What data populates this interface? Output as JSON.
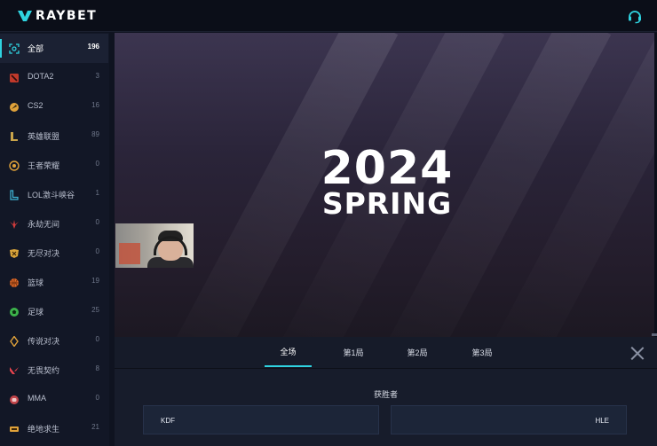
{
  "header": {
    "logo_text": "RAYBET",
    "support_icon": "headset-icon",
    "accent_color": "#2fd3e0"
  },
  "sidebar": {
    "items": [
      {
        "label": "全部",
        "count": "196",
        "icon": "all-games-icon",
        "active": true
      },
      {
        "label": "DOTA2",
        "count": "3",
        "icon": "dota2-icon"
      },
      {
        "label": "CS2",
        "count": "16",
        "icon": "cs2-icon"
      },
      {
        "label": "英雄联盟",
        "count": "89",
        "icon": "league-of-legends-icon"
      },
      {
        "label": "王者荣耀",
        "count": "0",
        "icon": "honor-of-kings-icon"
      },
      {
        "label": "LOL激斗峡谷",
        "count": "1",
        "icon": "wild-rift-icon"
      },
      {
        "label": "永劫无间",
        "count": "0",
        "icon": "naraka-icon"
      },
      {
        "label": "无尽对决",
        "count": "0",
        "icon": "mobile-legends-icon"
      },
      {
        "label": "篮球",
        "count": "19",
        "icon": "basketball-icon"
      },
      {
        "label": "足球",
        "count": "25",
        "icon": "football-icon"
      },
      {
        "label": "传说对决",
        "count": "0",
        "icon": "arena-of-valor-icon"
      },
      {
        "label": "无畏契约",
        "count": "8",
        "icon": "valorant-icon"
      },
      {
        "label": "MMA",
        "count": "0",
        "icon": "mma-icon"
      },
      {
        "label": "绝地求生",
        "count": "21",
        "icon": "pubg-icon"
      }
    ]
  },
  "stream": {
    "year": "2024",
    "season": "SPRING"
  },
  "match_panel": {
    "tabs": [
      {
        "label": "全场",
        "active": true
      },
      {
        "label": "第1局"
      },
      {
        "label": "第2局"
      },
      {
        "label": "第3局"
      }
    ],
    "close_icon": "close-icon",
    "market_title": "获胜者",
    "outcomes": [
      {
        "team": "KDF"
      },
      {
        "team": "HLE"
      }
    ]
  }
}
